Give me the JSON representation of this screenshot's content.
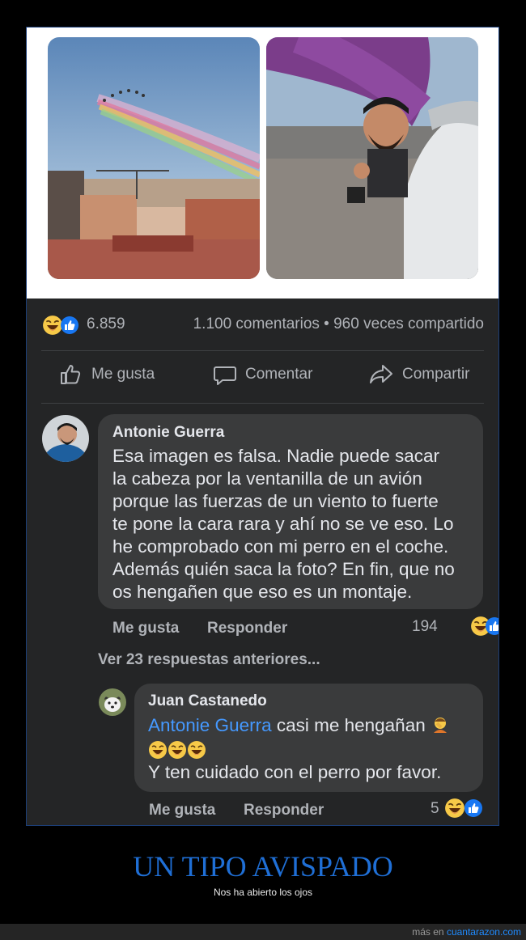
{
  "post": {
    "reaction_count": "6.859",
    "comments_shares": "1.100 comentarios • 960 veces compartido",
    "photos": [
      "photo-airshow-smoke",
      "photo-plane-window-selfie"
    ]
  },
  "actions": {
    "like": "Me gusta",
    "comment": "Comentar",
    "share": "Compartir"
  },
  "comment1": {
    "author": "Antonie Guerra",
    "text": "Esa imagen es falsa. Nadie puede sacar\nla cabeza por la ventanilla de un avión\nporque las fuerzas de un viento to fuerte\nte pone la cara rara y ahí no se ve eso. Lo\nhe comprobado con mi perro en el coche.\nAdemás quién saca la foto? En fin, que no\nos hengañen que eso es un montaje.",
    "like_label": "Me gusta",
    "reply_label": "Responder",
    "reaction_count": "194"
  },
  "view_more_replies": "Ver 23 respuestas anteriores...",
  "comment2": {
    "author": "Juan Castanedo",
    "mention": "Antonie Guerra",
    "text_line1": " casi me hengañan",
    "text_line3": "Y ten cuidado con el perro por favor.",
    "like_label": "Me gusta",
    "reply_label": "Responder",
    "reaction_count": "5"
  },
  "caption": {
    "title": "UN TIPO AVISPADO",
    "subtitle": "Nos ha abierto los ojos"
  },
  "footer": {
    "prefix": "más en ",
    "site": "cuantarazon.com"
  },
  "colors": {
    "background": "#000000",
    "card": "#242526",
    "bubble": "#3a3b3c",
    "text": "#e4e6eb",
    "muted": "#b0b3b8",
    "mention": "#4599ff",
    "title": "#1f6fd6",
    "link": "#1f8bff"
  }
}
